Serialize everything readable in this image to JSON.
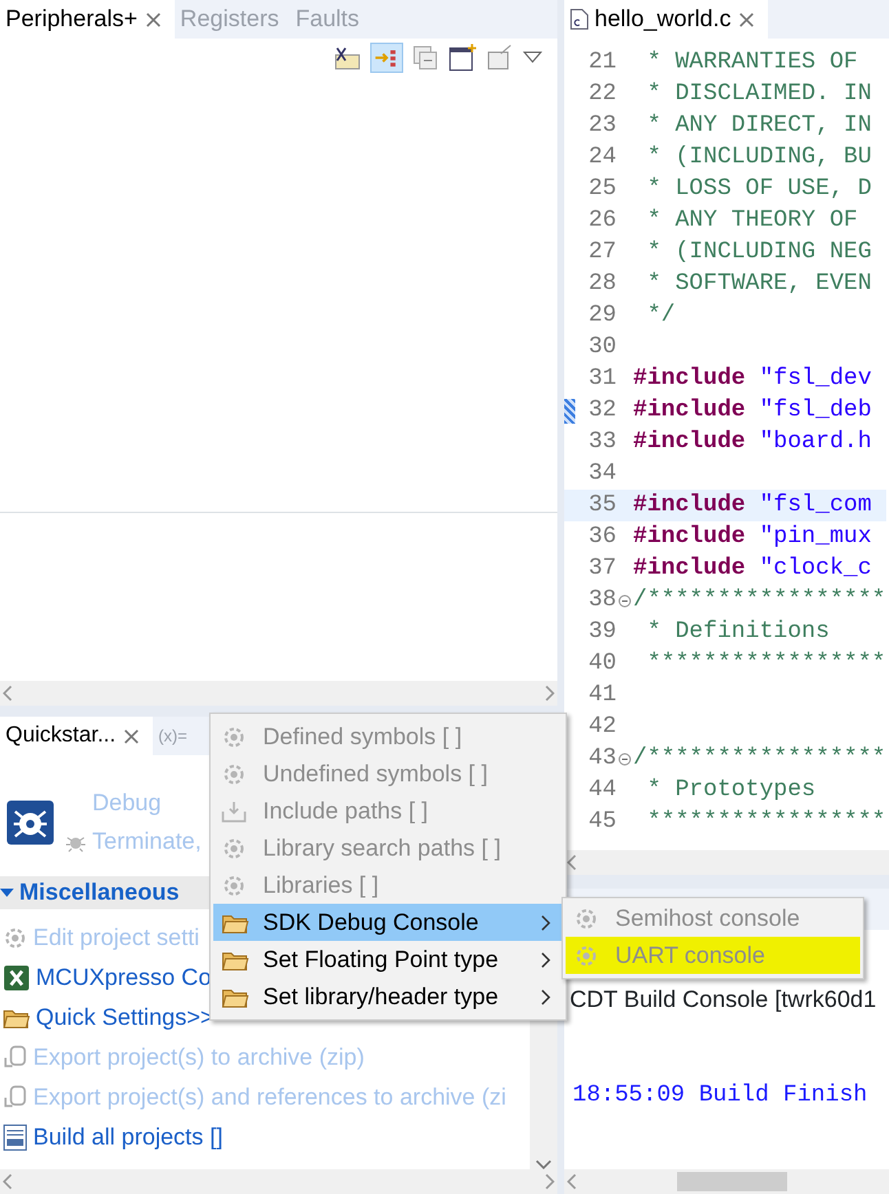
{
  "top_left": {
    "tabs": [
      {
        "label": "Peripherals+",
        "selected": true,
        "closable": true
      },
      {
        "label": "Registers",
        "selected": false,
        "closable": false
      },
      {
        "label": "Faults",
        "selected": false,
        "closable": false
      }
    ]
  },
  "quickstart": {
    "tabs": [
      {
        "label": "Quickstar...",
        "selected": true,
        "closable": true
      },
      {
        "label": "(x)=",
        "selected": false,
        "closable": false
      }
    ],
    "debug_actions": [
      {
        "label": "Debug"
      },
      {
        "label": "Terminate,"
      }
    ],
    "section": "Miscellaneous",
    "items": [
      {
        "label": "Edit project setti",
        "disabled": true,
        "kind": "setting"
      },
      {
        "label": "MCUXpresso Co",
        "disabled": false,
        "kind": "config"
      },
      {
        "label": "Quick Settings>>",
        "disabled": false,
        "kind": "folder"
      },
      {
        "label": "Export project(s) to archive (zip)",
        "disabled": true,
        "kind": "export"
      },
      {
        "label": "Export project(s) and references to archive (zi",
        "disabled": true,
        "kind": "export"
      },
      {
        "label": "Build all projects []",
        "disabled": false,
        "kind": "build"
      }
    ]
  },
  "editor": {
    "tab": "hello_world.c",
    "lines": [
      {
        "number": "21",
        "fold": false,
        "marked": false,
        "current": false,
        "tokens": [
          {
            "kind": "comment",
            "text": " * WARRANTIES OF"
          }
        ]
      },
      {
        "number": "22",
        "fold": false,
        "marked": false,
        "current": false,
        "tokens": [
          {
            "kind": "comment",
            "text": " * DISCLAIMED. IN"
          }
        ]
      },
      {
        "number": "23",
        "fold": false,
        "marked": false,
        "current": false,
        "tokens": [
          {
            "kind": "comment",
            "text": " * ANY DIRECT, IN"
          }
        ]
      },
      {
        "number": "24",
        "fold": false,
        "marked": false,
        "current": false,
        "tokens": [
          {
            "kind": "comment",
            "text": " * (INCLUDING, BU"
          }
        ]
      },
      {
        "number": "25",
        "fold": false,
        "marked": false,
        "current": false,
        "tokens": [
          {
            "kind": "comment",
            "text": " * LOSS OF USE, D"
          }
        ]
      },
      {
        "number": "26",
        "fold": false,
        "marked": false,
        "current": false,
        "tokens": [
          {
            "kind": "comment",
            "text": " * ANY THEORY OF"
          }
        ]
      },
      {
        "number": "27",
        "fold": false,
        "marked": false,
        "current": false,
        "tokens": [
          {
            "kind": "comment",
            "text": " * (INCLUDING NEG"
          }
        ]
      },
      {
        "number": "28",
        "fold": false,
        "marked": false,
        "current": false,
        "tokens": [
          {
            "kind": "comment",
            "text": " * SOFTWARE, EVEN"
          }
        ]
      },
      {
        "number": "29",
        "fold": false,
        "marked": false,
        "current": false,
        "tokens": [
          {
            "kind": "comment",
            "text": " */"
          }
        ]
      },
      {
        "number": "30",
        "fold": false,
        "marked": false,
        "current": false
      },
      {
        "number": "31",
        "fold": false,
        "marked": false,
        "current": false,
        "tokens": [
          {
            "kind": "keyword",
            "text": "#include"
          },
          {
            "kind": "string",
            "text": "\"fsl_dev"
          }
        ]
      },
      {
        "number": "32",
        "fold": false,
        "marked": true,
        "current": false,
        "tokens": [
          {
            "kind": "keyword",
            "text": "#include"
          },
          {
            "kind": "string",
            "text": "\"fsl_deb"
          }
        ]
      },
      {
        "number": "33",
        "fold": false,
        "marked": false,
        "current": false,
        "tokens": [
          {
            "kind": "keyword",
            "text": "#include"
          },
          {
            "kind": "string",
            "text": "\"board.h"
          }
        ]
      },
      {
        "number": "34",
        "fold": false,
        "marked": false,
        "current": false
      },
      {
        "number": "35",
        "fold": false,
        "marked": false,
        "current": true,
        "tokens": [
          {
            "kind": "keyword",
            "text": "#include"
          },
          {
            "kind": "string",
            "text": "\"fsl_com"
          }
        ]
      },
      {
        "number": "36",
        "fold": false,
        "marked": false,
        "current": false,
        "tokens": [
          {
            "kind": "keyword",
            "text": "#include"
          },
          {
            "kind": "string",
            "text": "\"pin_mux"
          }
        ]
      },
      {
        "number": "37",
        "fold": false,
        "marked": false,
        "current": false,
        "tokens": [
          {
            "kind": "keyword",
            "text": "#include"
          },
          {
            "kind": "string",
            "text": "\"clock_c"
          }
        ]
      },
      {
        "number": "38",
        "fold": true,
        "marked": false,
        "current": false,
        "tokens": [
          {
            "kind": "comment",
            "text": "/*****************"
          }
        ]
      },
      {
        "number": "39",
        "fold": false,
        "marked": false,
        "current": false,
        "tokens": [
          {
            "kind": "comment",
            "text": " * Definitions"
          }
        ]
      },
      {
        "number": "40",
        "fold": false,
        "marked": false,
        "current": false,
        "tokens": [
          {
            "kind": "comment",
            "text": " *****************"
          }
        ]
      },
      {
        "number": "41",
        "fold": false,
        "marked": false,
        "current": false
      },
      {
        "number": "42",
        "fold": false,
        "marked": false,
        "current": false
      },
      {
        "number": "43",
        "fold": true,
        "marked": false,
        "current": false,
        "tokens": [
          {
            "kind": "comment",
            "text": "/*****************"
          }
        ]
      },
      {
        "number": "44",
        "fold": false,
        "marked": false,
        "current": false,
        "tokens": [
          {
            "kind": "comment",
            "text": " * Prototypes"
          }
        ]
      },
      {
        "number": "45",
        "fold": false,
        "marked": false,
        "current": false,
        "tokens": [
          {
            "kind": "comment",
            "text": " *****************"
          }
        ]
      }
    ]
  },
  "console": {
    "title": "CDT Build Console [twrk60d1",
    "lines": [
      "18:55:09 Build Finish"
    ]
  },
  "context_menu": {
    "items": [
      {
        "label": "Defined symbols [ ]",
        "disabled": true,
        "selected": false,
        "submenu": false,
        "kind": "setting"
      },
      {
        "label": "Undefined symbols [ ]",
        "disabled": true,
        "selected": false,
        "submenu": false,
        "kind": "setting"
      },
      {
        "label": "Include paths [ ]",
        "disabled": true,
        "selected": false,
        "submenu": false,
        "kind": "path"
      },
      {
        "label": "Library search paths [ ]",
        "disabled": true,
        "selected": false,
        "submenu": false,
        "kind": "setting"
      },
      {
        "label": "Libraries [ ]",
        "disabled": true,
        "selected": false,
        "submenu": false,
        "kind": "setting"
      },
      {
        "label": "SDK Debug Console",
        "disabled": false,
        "selected": true,
        "submenu": true,
        "kind": "folder"
      },
      {
        "label": "Set Floating Point type",
        "disabled": false,
        "selected": false,
        "submenu": true,
        "kind": "folder"
      },
      {
        "label": "Set library/header type",
        "disabled": false,
        "selected": false,
        "submenu": true,
        "kind": "folder"
      }
    ]
  },
  "submenu": {
    "items": [
      {
        "label": "Semihost console",
        "disabled": true,
        "highlighted": false
      },
      {
        "label": "UART console",
        "disabled": true,
        "highlighted": true
      }
    ]
  }
}
